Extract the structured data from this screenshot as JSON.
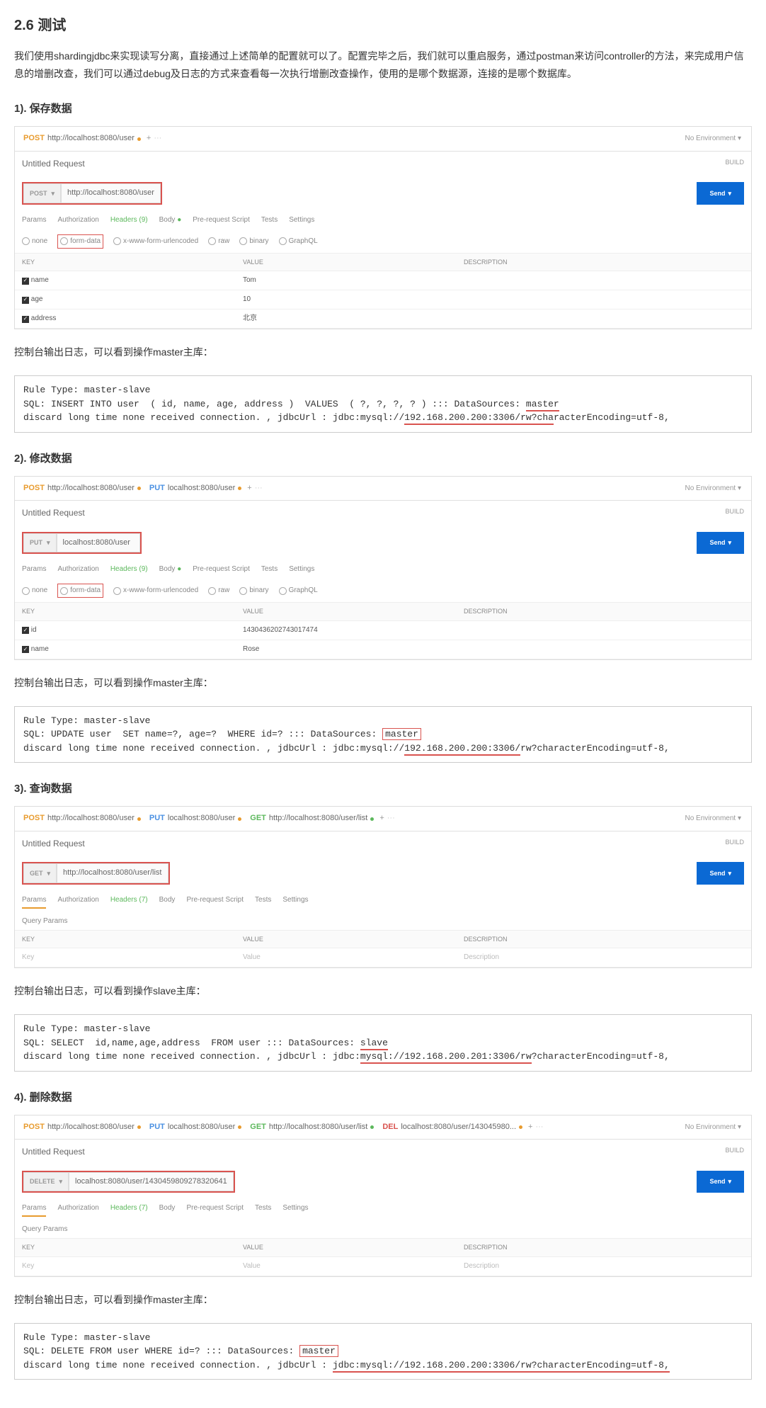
{
  "h": "2.6 测试",
  "intro": "我们使用shardingjdbc来实现读写分离，直接通过上述简单的配置就可以了。配置完毕之后，我们就可以重启服务，通过postman来访问controller的方法，来完成用户信息的增删改查，我们可以通过debug及日志的方式来查看每一次执行增删改查操作，使用的是哪个数据源，连接的是哪个数据库。",
  "env": "No Environment",
  "ut": "Untitled Request",
  "build": "BUILD",
  "send": "Send",
  "st": {
    "params": "Params",
    "auth": "Authorization",
    "headers9": "Headers (9)",
    "headers7": "Headers (7)",
    "body": "Body",
    "pre": "Pre-request Script",
    "tests": "Tests",
    "settings": "Settings"
  },
  "rd": {
    "none": "none",
    "form": "form-data",
    "xwww": "x-www-form-urlencoded",
    "raw": "raw",
    "binary": "binary",
    "gql": "GraphQL"
  },
  "th": {
    "key": "KEY",
    "value": "VALUE",
    "desc": "DESCRIPTION"
  },
  "qp": "Query Params",
  "s1": {
    "title": "1). 保存数据",
    "tabs": [
      {
        "m": "POST",
        "u": "http://localhost:8080/user",
        "d": "dy"
      }
    ],
    "method": "POST",
    "url": "http://localhost:8080/user",
    "rows": [
      [
        "name",
        "Tom"
      ],
      [
        "age",
        "10"
      ],
      [
        "address",
        "北京"
      ]
    ],
    "caption": "控制台输出日志，可以看到操作master主库：",
    "log": {
      "l1": "Rule Type: master-slave",
      "l2a": "SQL: INSERT INTO user  ( id, name, age, address )  VALUES  ( ?, ?, ?, ? ) ::: DataSources: ",
      "l2b": "master",
      "l3a": "discard long time none received connection. , jdbcUrl : jdbc:mysql://",
      "l3b": "192.168.200.200:3306/rw?cha",
      "l3c": "racterEncoding=utf-8,"
    }
  },
  "s2": {
    "title": "2). 修改数据",
    "tabs": [
      {
        "m": "POST",
        "u": "http://localhost:8080/user",
        "d": "dy"
      },
      {
        "m": "PUT",
        "u": "localhost:8080/user",
        "d": "db"
      }
    ],
    "method": "PUT",
    "url": "localhost:8080/user",
    "rows": [
      [
        "id",
        "1430436202743017474"
      ],
      [
        "name",
        "Rose"
      ]
    ],
    "caption": "控制台输出日志，可以看到操作master主库：",
    "log": {
      "l1": "Rule Type: master-slave",
      "l2a": "SQL: UPDATE user  SET name=?, age=?  WHERE id=? ::: DataSources: ",
      "l2b": "master",
      "l3a": "discard long time none received connection. , jdbcUrl : jdbc:mysql://",
      "l3b": "192.168.200.200:3306/",
      "l3c": "rw?characterEncoding=utf-8,"
    }
  },
  "s3": {
    "title": "3). 查询数据",
    "tabs": [
      {
        "m": "POST",
        "u": "http://localhost:8080/user",
        "d": "dy"
      },
      {
        "m": "PUT",
        "u": "localhost:8080/user",
        "d": "db"
      },
      {
        "m": "GET",
        "u": "http://localhost:8080/user/list",
        "d": "dg"
      }
    ],
    "method": "GET",
    "url": "http://localhost:8080/user/list",
    "rows": [
      [
        "Key",
        "Value",
        "Description"
      ]
    ],
    "caption": "控制台输出日志，可以看到操作slave主库：",
    "log": {
      "l1": "Rule Type: master-slave",
      "l2a": "SQL: SELECT  id,name,age,address  FROM user ::: DataSources: ",
      "l2b": "slave",
      "l3a": "discard long time none received connection. , jdbcUrl : jdbc:",
      "l3b": "mysql://",
      "l3c": "192.168.200.201:3306/rw",
      "l3d": "?characterEncoding=utf-8,"
    }
  },
  "s4": {
    "title": "4). 删除数据",
    "tabs": [
      {
        "m": "POST",
        "u": "http://localhost:8080/user",
        "d": "dy"
      },
      {
        "m": "PUT",
        "u": "localhost:8080/user",
        "d": "db"
      },
      {
        "m": "GET",
        "u": "http://localhost:8080/user/list",
        "d": "dg"
      },
      {
        "m": "DEL",
        "u": "localhost:8080/user/143045980...",
        "d": "dr"
      }
    ],
    "method": "DELETE",
    "url": "localhost:8080/user/1430459809278320641",
    "rows": [
      [
        "Key",
        "Value",
        "Description"
      ]
    ],
    "caption": "控制台输出日志，可以看到操作master主库：",
    "log": {
      "l1": "Rule Type: master-slave",
      "l2a": "SQL: DELETE FROM user WHERE id=? ::: DataSources: ",
      "l2b": "master",
      "l3a": "discard long time none received connection. , jdbcUrl : ",
      "l3b": "jdbc:mysql://192.168.200.200:3306/rw?characterEncoding=utf-8,"
    }
  }
}
